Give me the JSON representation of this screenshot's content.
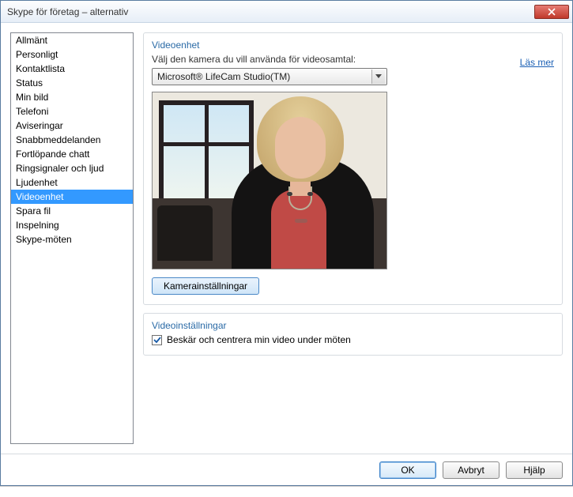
{
  "window": {
    "title": "Skype för företag – alternativ"
  },
  "sidebar": {
    "items": [
      {
        "label": "Allmänt"
      },
      {
        "label": "Personligt"
      },
      {
        "label": "Kontaktlista"
      },
      {
        "label": "Status"
      },
      {
        "label": "Min bild"
      },
      {
        "label": "Telefoni"
      },
      {
        "label": "Aviseringar"
      },
      {
        "label": "Snabbmeddelanden"
      },
      {
        "label": "Fortlöpande chatt"
      },
      {
        "label": "Ringsignaler och ljud"
      },
      {
        "label": "Ljudenhet"
      },
      {
        "label": "Videoenhet"
      },
      {
        "label": "Spara fil"
      },
      {
        "label": "Inspelning"
      },
      {
        "label": "Skype-möten"
      }
    ],
    "selected_index": 11
  },
  "video_device": {
    "group_title": "Videoenhet",
    "instruction": "Välj den kamera du vill använda för videosamtal:",
    "learn_more": "Läs mer",
    "selected_camera": "Microsoft® LifeCam Studio(TM)",
    "camera_settings_button": "Kamerainställningar"
  },
  "video_settings": {
    "group_title": "Videoinställningar",
    "crop_center_checked": true,
    "crop_center_label": "Beskär och centrera min video under möten"
  },
  "footer": {
    "ok": "OK",
    "cancel": "Avbryt",
    "help": "Hjälp"
  }
}
